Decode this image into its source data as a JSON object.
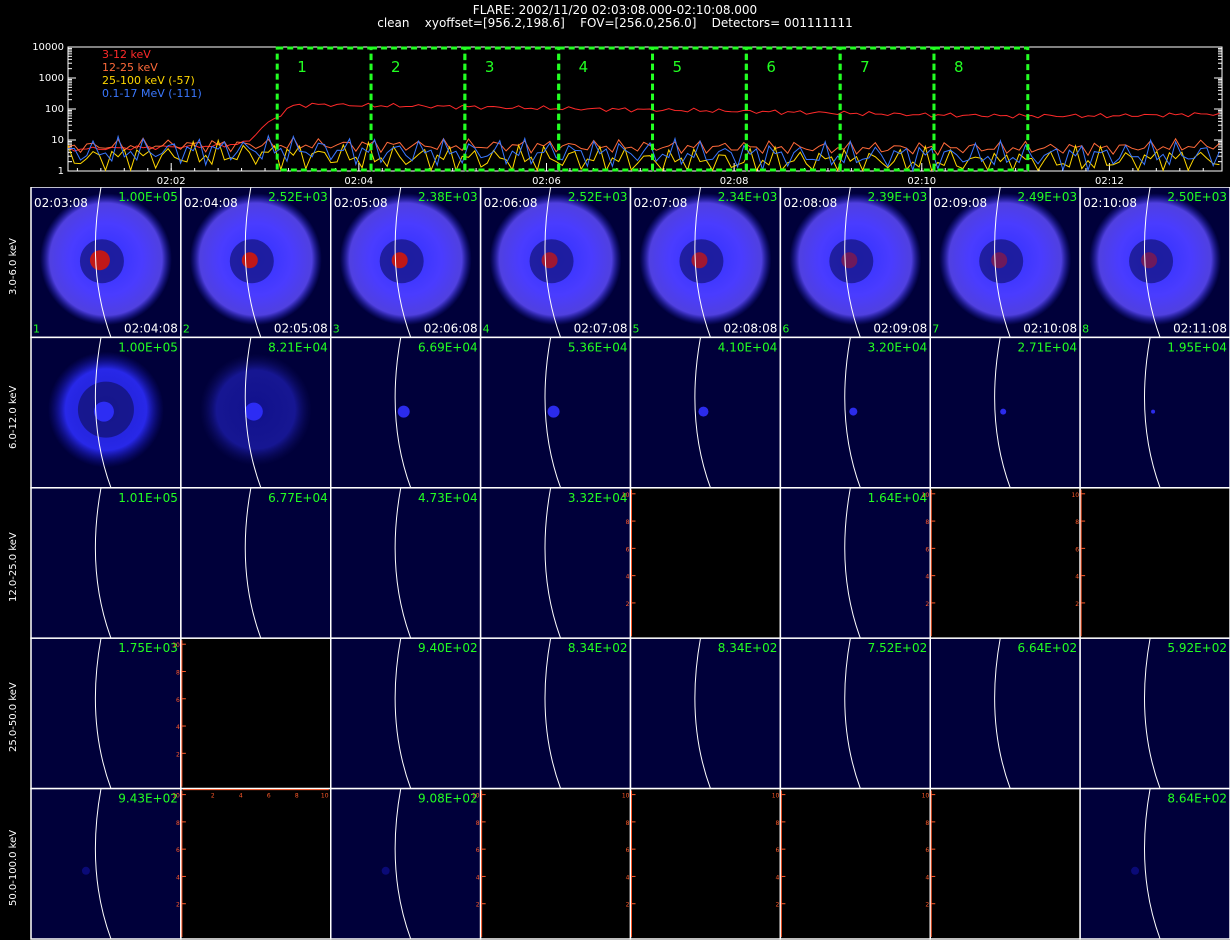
{
  "header": {
    "line1": "FLARE: 2002/11/20 02:03:08.000-02:10:08.000",
    "line2": "clean    xyoffset=[956.2,198.6]    FOV=[256.0,256.0]    Detectors= 001111111"
  },
  "chart_data": {
    "type": "line",
    "x_tick_labels": [
      "02:02",
      "02:04",
      "02:06",
      "02:08",
      "02:10",
      "02:12"
    ],
    "x_tick_minutes": [
      2,
      4,
      6,
      8,
      10,
      12
    ],
    "xlim_minutes": [
      0.9,
      13.2
    ],
    "ylim": [
      1,
      10000
    ],
    "y_scale": "log",
    "y_tick_labels": [
      "1",
      "10",
      "100",
      "1000",
      "10000"
    ],
    "series": [
      {
        "name": "3-12 keV",
        "color": "#ff2a2a",
        "x": [
          0.9,
          1.5,
          2.0,
          2.5,
          2.8,
          3.0,
          3.3,
          3.6,
          4,
          5,
          6,
          7,
          8,
          9,
          10,
          11,
          12,
          13.2
        ],
        "values": [
          5,
          5.5,
          6,
          6.5,
          8,
          30,
          130,
          140,
          130,
          120,
          105,
          95,
          85,
          75,
          65,
          60,
          60,
          70
        ]
      },
      {
        "name": "12-25 keV",
        "color": "#ff6a3a",
        "x": [
          0.9,
          2,
          3,
          4,
          5,
          6,
          7,
          8,
          9,
          10,
          11,
          12,
          13.2
        ],
        "values": [
          6,
          7,
          7,
          7,
          6.5,
          6.5,
          6,
          6,
          5.5,
          5.5,
          5.5,
          5.5,
          7
        ]
      },
      {
        "name": "25-100 keV (-57)",
        "color": "#ffd700",
        "x": [
          0.9,
          2,
          3,
          4,
          5,
          6,
          7,
          8,
          9,
          10,
          11,
          12,
          13.2
        ],
        "values": [
          2.5,
          3,
          3.5,
          2.8,
          2.5,
          2.5,
          2.2,
          2,
          2.2,
          2,
          2,
          2.2,
          2.5
        ]
      },
      {
        "name": "0.1-17 MeV (-111)",
        "color": "#3a78ff",
        "x": [
          0.9,
          2,
          3,
          4,
          5,
          6,
          7,
          8,
          9,
          10,
          11,
          12,
          13.2
        ],
        "values": [
          4,
          4.5,
          5,
          4.5,
          4,
          4,
          3.8,
          3.5,
          3,
          3.2,
          3,
          3.2,
          3.5
        ]
      }
    ],
    "intervals": {
      "labels": [
        "1",
        "2",
        "3",
        "4",
        "5",
        "6",
        "7",
        "8"
      ],
      "start_minutes": [
        3.13,
        4.13,
        5.13,
        6.13,
        7.13,
        8.13,
        9.13,
        10.13
      ],
      "end_minutes": [
        4.13,
        5.13,
        6.13,
        7.13,
        8.13,
        9.13,
        10.13,
        11.13
      ],
      "color": "#22ff22"
    }
  },
  "image_grid": {
    "row_labels": [
      "3.0-6.0 keV",
      "6.0-12.0 keV",
      "12.0-25.0 keV",
      "25.0-50.0 keV",
      "50.0-100.0 keV"
    ],
    "start_times": [
      "02:03:08",
      "02:04:08",
      "02:05:08",
      "02:06:08",
      "02:07:08",
      "02:08:08",
      "02:09:08",
      "02:10:08"
    ],
    "end_times": [
      "02:04:08",
      "02:05:08",
      "02:06:08",
      "02:07:08",
      "02:08:08",
      "02:09:08",
      "02:10:08",
      "02:11:08"
    ],
    "interval_numbers": [
      "1",
      "2",
      "3",
      "4",
      "5",
      "6",
      "7",
      "8"
    ],
    "rows": [
      [
        "1.00E+05",
        "2.52E+03",
        "2.38E+03",
        "2.52E+03",
        "2.34E+03",
        "2.39E+03",
        "2.49E+03",
        "2.50E+03"
      ],
      [
        "1.00E+05",
        "8.21E+04",
        "6.69E+04",
        "5.36E+04",
        "4.10E+04",
        "3.20E+04",
        "2.71E+04",
        "1.95E+04"
      ],
      [
        "1.01E+05",
        "6.77E+04",
        "4.73E+04",
        "3.32E+04",
        "",
        "1.64E+04",
        "",
        ""
      ],
      [
        "1.75E+03",
        "",
        "9.40E+02",
        "8.34E+02",
        "8.34E+02",
        "7.52E+02",
        "6.64E+02",
        "5.92E+02"
      ],
      [
        "9.43E+02",
        "",
        "9.08E+02",
        "",
        "",
        "",
        "",
        "8.64E+02"
      ]
    ],
    "empty_axis_ticks": [
      "2",
      "4",
      "6",
      "8",
      "10"
    ],
    "colors": {
      "panel_bg": "#00003a",
      "empty_bg": "#000000",
      "limb": "#ffffff",
      "text": "#22ff22",
      "axis": "#ff5a2a"
    }
  }
}
